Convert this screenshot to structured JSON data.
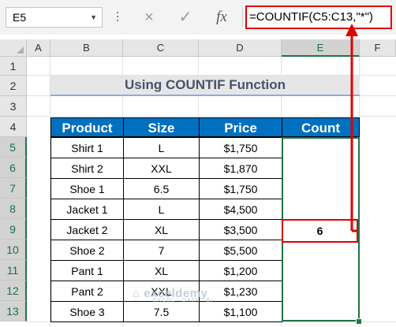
{
  "formula_bar": {
    "name_box": "E5",
    "cancel_icon": "×",
    "enter_icon": "✓",
    "fx_label": "fx",
    "formula": "=COUNTIF(C5:C13,\"*\")"
  },
  "columns": [
    "A",
    "B",
    "C",
    "D",
    "E",
    "F"
  ],
  "rows": [
    "1",
    "2",
    "3",
    "4",
    "5",
    "6",
    "7",
    "8",
    "9",
    "10",
    "11",
    "12",
    "13"
  ],
  "title": "Using COUNTIF Function",
  "table": {
    "headers": [
      "Product",
      "Size",
      "Price",
      "Count"
    ],
    "rows": [
      [
        "Shirt 1",
        "L",
        "$1,750"
      ],
      [
        "Shirt 2",
        "XXL",
        "$1,870"
      ],
      [
        "Shoe 1",
        "6.5",
        "$1,750"
      ],
      [
        "Jacket 1",
        "L",
        "$4,500"
      ],
      [
        "Jacket 2",
        "XL",
        "$3,500"
      ],
      [
        "Shoe 2",
        "7",
        "$5,500"
      ],
      [
        "Pant 1",
        "XL",
        "$1,200"
      ],
      [
        "Pant 2",
        "XXL",
        "$1,230"
      ],
      [
        "Shoe 3",
        "7.5",
        "$1,100"
      ]
    ],
    "count_result": "6"
  },
  "watermark": {
    "brand": "exceldemy",
    "tagline": "EXCEL · DATA · BI"
  },
  "colors": {
    "header_blue": "#0070c0",
    "highlight_red": "#e00000",
    "excel_green": "#217346"
  }
}
